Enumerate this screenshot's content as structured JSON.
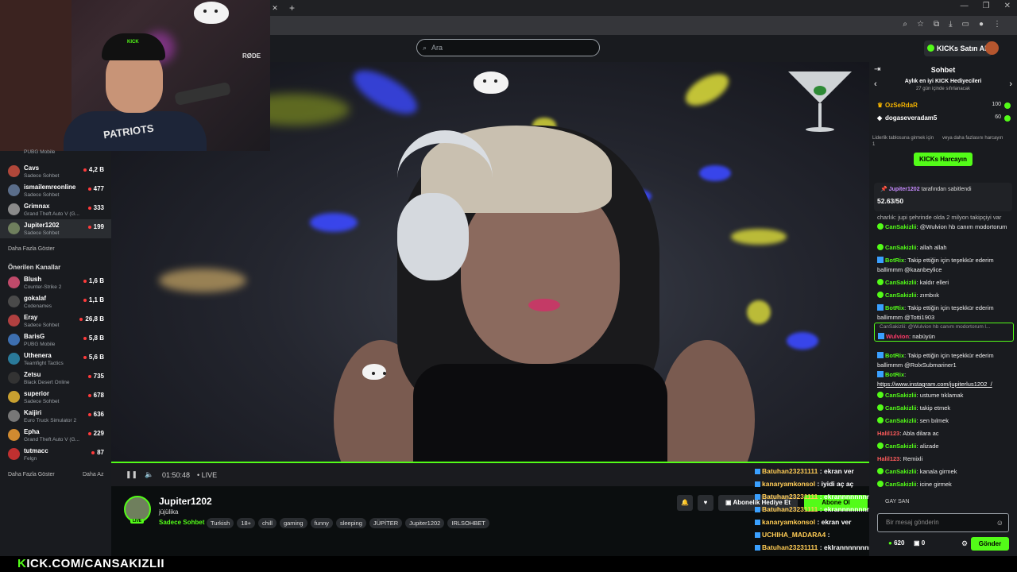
{
  "browser": {
    "tab_close": "✕",
    "tab_new": "+",
    "win_controls": [
      "—",
      "❐",
      "✕"
    ]
  },
  "nav": {
    "search_placeholder": "Ara",
    "kicks_button": "KICKs Satın Al"
  },
  "webcam": {
    "cap_logo": "KICK",
    "shirt_text": "PATRIOTS",
    "mic_brand": "RØDE"
  },
  "sidebar": {
    "top_channels": [
      {
        "name": "Cavs",
        "category": "Sadece Sohbet",
        "viewers": "4,2 B",
        "color": "#b0473a"
      },
      {
        "name": "ismailemreonline",
        "category": "Sadece Sohbet",
        "viewers": "477",
        "color": "#5a6d8a"
      },
      {
        "name": "Grimnax",
        "category": "Grand Theft Auto V (G...",
        "viewers": "333",
        "color": "#8a8a8a"
      },
      {
        "name": "Jupiter1202",
        "category": "Sadece Sohbet",
        "viewers": "199",
        "color": "#6f7f5d"
      }
    ],
    "top_partial": {
      "category": "PUBG Mobile"
    },
    "show_more": "Daha Fazla Göster",
    "recommended_title": "Önerilen Kanallar",
    "recommended": [
      {
        "name": "Blush",
        "category": "Counter-Strike 2",
        "viewers": "1,6 B",
        "color": "#c04a6a"
      },
      {
        "name": "gokalaf",
        "category": "Codenames",
        "viewers": "1,1 B",
        "color": "#4a4a4a"
      },
      {
        "name": "Eray",
        "category": "Sadece Sohbet",
        "viewers": "26,8 B",
        "color": "#b04040"
      },
      {
        "name": "BarisG",
        "category": "PUBG Mobile",
        "viewers": "5,8 B",
        "color": "#3d6fb0"
      },
      {
        "name": "Uthenera",
        "category": "Teamfight Tactics",
        "viewers": "5,6 B",
        "color": "#2a7a9a"
      },
      {
        "name": "Zetsu",
        "category": "Black Desert Online",
        "viewers": "735",
        "color": "#333"
      },
      {
        "name": "superior",
        "category": "Sadece Sohbet",
        "viewers": "678",
        "color": "#c8a030"
      },
      {
        "name": "Kaijiri",
        "category": "Euro Truck Simulator 2",
        "viewers": "636",
        "color": "#777"
      },
      {
        "name": "Epha",
        "category": "Grand Theft Auto V (G...",
        "viewers": "229",
        "color": "#d08a30"
      },
      {
        "name": "tutmacc",
        "category": "Felgn",
        "viewers": "87",
        "color": "#c03030"
      }
    ],
    "show_more_2": "Daha Fazla Göster",
    "collapse": "Daha Az"
  },
  "video": {
    "time": "01:50:48",
    "live": "LIVE",
    "pause_icon": "❚❚",
    "volume_icon": "🔈"
  },
  "channel": {
    "name": "Jupiter1202",
    "title": "jüjülika",
    "category": "Sadece Sohbet",
    "live_badge": "LIVE",
    "tags": [
      "Turkish",
      "18+",
      "chill",
      "gaming",
      "funny",
      "sleeping",
      "JÜPİTER",
      "Jupiter1202",
      "IRLSOHBET"
    ],
    "gift_button": "Abonelik Hediye Et",
    "subscribe_button": "Abone Ol"
  },
  "overlay_chat": [
    {
      "user": "Batuhan23231111",
      "text": " : ekran ver"
    },
    {
      "user": "kanaryamkonsol",
      "text": " : iyidi aç aç"
    },
    {
      "user": "Batuhan23231111",
      "text": " : ekrannnnnnnnnnn"
    },
    {
      "user": "Batuhan23231111",
      "text": " : ekrannnnnnnnnnn"
    },
    {
      "user": "kanaryamkonsol",
      "text": " : ekran ver"
    },
    {
      "user": "UCHIHA_MADARA4",
      "text": " :"
    },
    {
      "user": "Batuhan23231111",
      "text": " : eklrannnnnnnnnn"
    }
  ],
  "brand_footer": "KICK.COM/CANSAKIZLII",
  "chat": {
    "title": "Sohbet",
    "leaderboard_title": "Aylık en iyi KICK Hediyecileri",
    "leaderboard_sub": "27 gün içinde sıfırlanacak",
    "leaderboard": [
      {
        "rank": "1",
        "name": "OzSeRdaR",
        "points": "100"
      },
      {
        "rank": "2",
        "name": "dogaseveradam5",
        "points": "60"
      }
    ],
    "lb_note_left": "Liderlik tablosuna girmek için 1",
    "lb_note_right": "veya daha fazlasını harcayın",
    "kicks_spend": "KICKs Harcayın",
    "pinned_by_user": "Jupiter1202",
    "pinned_by_text": " tarafından sabitlendi",
    "pinned_value": "52.63/50",
    "messages": [
      {
        "type": "text",
        "text": "charlık: jupi şehrinde olda 2 milyon takipçiyi var"
      },
      {
        "type": "user",
        "user": "CanSakizlii",
        "text": ": @Wulvion hb canım modortorum"
      },
      {
        "type": "user",
        "user": "CanSakizlii",
        "text": ": allah allah"
      },
      {
        "type": "bot",
        "user": "BotRix",
        "text": ": Takip ettiğin için teşekkür ederim ballimmm @kaanbeylice"
      },
      {
        "type": "user",
        "user": "CanSakizlii",
        "text": ": kaldır elleri"
      },
      {
        "type": "user",
        "user": "CanSakizlii",
        "text": ": zımbıık"
      },
      {
        "type": "bot",
        "user": "BotRix",
        "text": ": Takip ettiğin için teşekkür ederim ballimmm @Totti1903"
      },
      {
        "type": "reply",
        "context": "CanSakizlii: @Wulvion hb canım modortorum l...",
        "user": "Wulvion",
        "text": ": nabüyün"
      },
      {
        "type": "bot",
        "user": "BotRix",
        "text": ": Takip ettiğin için teşekkür ederim ballimmm @RolxSubmariner1"
      },
      {
        "type": "bot",
        "user": "BotRix",
        "text": ":"
      },
      {
        "type": "link",
        "text": "https://www.instagram.com/jupiterlus1202_/"
      },
      {
        "type": "user",
        "user": "CanSakizlii",
        "text": ": ustume tıklamak"
      },
      {
        "type": "user",
        "user": "CanSakizlii",
        "text": ": takip etmek"
      },
      {
        "type": "user",
        "user": "CanSakizlii",
        "text": ": sen bılmek"
      },
      {
        "type": "red",
        "user": "Halil123",
        "text": ": Abla dilara ac"
      },
      {
        "type": "user",
        "user": "CanSakizlii",
        "text": ": alizade"
      },
      {
        "type": "red",
        "user": "Halil123",
        "text": ": Remixli"
      },
      {
        "type": "user",
        "user": "CanSakizlii",
        "text": ": kanala girmek"
      },
      {
        "type": "user",
        "user": "CanSakizlii",
        "text": ": icine girmek"
      }
    ],
    "emotes_label": "GAY  SAN",
    "input_placeholder": "Bir mesaj gönderin",
    "coins": "620",
    "zero": "0",
    "send_button": "Gönder"
  }
}
